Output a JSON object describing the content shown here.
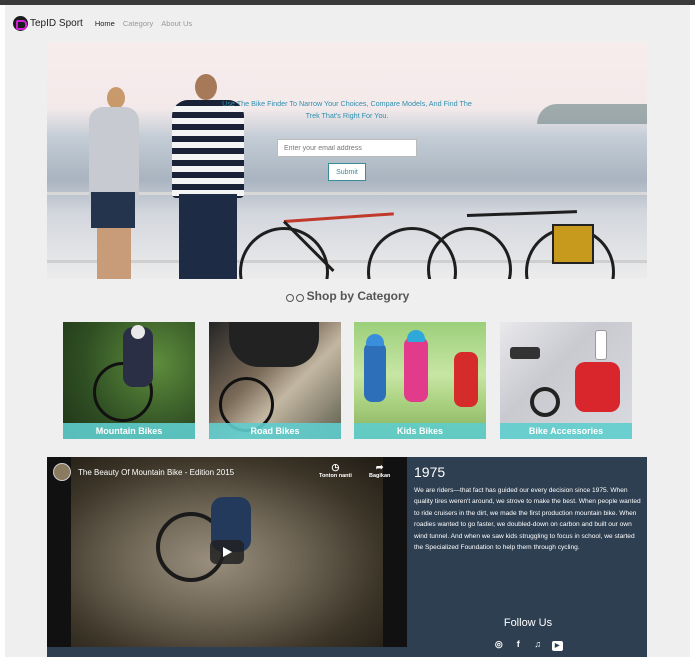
{
  "nav": {
    "brand": "TepID Sport",
    "links": [
      {
        "label": "Home",
        "active": true
      },
      {
        "label": "Category",
        "active": false
      },
      {
        "label": "About Us",
        "active": false
      }
    ]
  },
  "hero": {
    "tagline": "Use The Bike Finder To Narrow Your Choices, Compare Models, And Find The Trek That's Right For You.",
    "email_placeholder": "Enter your email address",
    "submit_label": "Submit"
  },
  "shop": {
    "title": "Shop by Category",
    "icon": "bicycle-icon",
    "categories": [
      {
        "label": "Mountain Bikes"
      },
      {
        "label": "Road Bikes"
      },
      {
        "label": "Kids Bikes"
      },
      {
        "label": "Bike Accessories"
      }
    ],
    "label_color": "#5fcdcd"
  },
  "video": {
    "title": "The Beauty Of Mountain Bike - Edition 2015",
    "watch_later": "Tonton nanti",
    "share": "Bagikan"
  },
  "story": {
    "year": "1975",
    "text": "We are riders—that fact has guided our every decision since 1975. When quality tires weren't around, we strove to make the best. When people wanted to ride cruisers in the dirt, we made the first production mountain bike. When roadies wanted to go faster, we doubled-down on carbon and built our own wind tunnel. And when we saw kids struggling to focus in school, we started the Specialized Foundation to help them through cycling."
  },
  "follow": {
    "title": "Follow Us",
    "icons": [
      "instagram-icon",
      "facebook-icon",
      "twitter-icon",
      "youtube-icon"
    ]
  },
  "colors": {
    "footer_bg": "#2e3f51",
    "accent": "#2f8fae"
  }
}
